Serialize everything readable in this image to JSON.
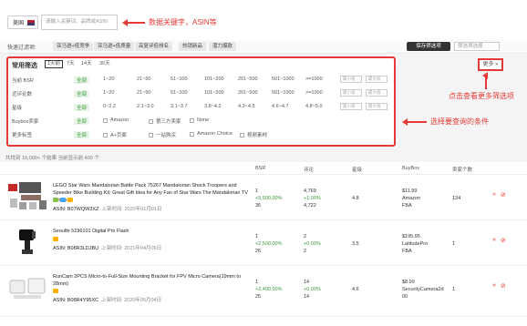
{
  "topbar": {
    "market_label": "美国",
    "search_placeholder": "请输入关键词、品牌或ASIN",
    "search_annotation": "数据关键字，ASIN等"
  },
  "filterbar": {
    "label": "快速过滤项:",
    "chips": [
      "亚马逊+低竞争",
      "亚马逊+低质量",
      "高复评低排名",
      "热销新品",
      "潜力爆款"
    ],
    "save_label": "保存筛选项",
    "select_placeholder": "筛选项选择"
  },
  "panel": {
    "title": "常用筛选",
    "ranges": [
      "1天前",
      "7天",
      "14天",
      "30天"
    ],
    "rows": [
      {
        "label": "当前 BSR",
        "options": [
          "全部",
          "1~20",
          "21~50",
          "51~100",
          "101~200",
          "201~500",
          "501~1000",
          ">=1000"
        ],
        "min": "最小值",
        "max": "最大值"
      },
      {
        "label": "近评论数",
        "options": [
          "全部",
          "1~20",
          "21~50",
          "51~100",
          "101~200",
          "201~500",
          "501~1000",
          ">=1000"
        ],
        "min": "最小值",
        "max": "最大值"
      },
      {
        "label": "星级",
        "options": [
          "全部",
          "0~2.2",
          "2.1~3.0",
          "3.1~3.7",
          "3.8~4.2",
          "4.3~4.5",
          "4.6~4.7",
          "4.8~5.0"
        ],
        "min": "最小值",
        "max": "最大值"
      },
      {
        "label": "Buybox卖家",
        "options": [
          "全部"
        ],
        "checks": [
          "Amazon",
          "第三方卖家",
          "None"
        ]
      },
      {
        "label": "更多标签",
        "options": [
          "全部"
        ],
        "checks": [
          "A+页面",
          "一站购买",
          "Amazon Choice",
          "视频素材"
        ]
      }
    ],
    "annotation": "选择要查询的条件"
  },
  "more": {
    "label": "更多 »",
    "annotation": "点击查看更多筛选项"
  },
  "results": {
    "summary": "共找到 16,000+ 个结果  当前显示前 400 个"
  },
  "table": {
    "headers": {
      "bsr": "BSR",
      "reviews": "评论",
      "rating": "星级",
      "buybox": "BuyBox",
      "sellers": "卖家个数"
    },
    "rows": [
      {
        "title": "LEGO Star Wars Mandalorian Battle Pack 75267 Mandalorian Shock Troopers and Speeder Bike Building Kit; Great Gift Idea for Any Fan of Star Wars The Mandalorian TV Series...",
        "asin": "ASIN: B07WQW3XZ",
        "launch": "上架时间: 2020年01月01日",
        "bsr": [
          "1",
          "+5,500.00%",
          "36"
        ],
        "reviews": [
          "4,769",
          "+1.00%",
          "4,722"
        ],
        "rating": "4.8",
        "buybox": [
          "$11.99",
          "Amazon",
          "FBA"
        ],
        "sellers": "134"
      },
      {
        "title": "Seoulfe 5196101 Digital Pro Flash",
        "asin": "ASIN: B08R3LDJBU",
        "launch": "上架时间: 2021年04月06日",
        "bsr": [
          "1",
          "+2,500.00%",
          "26"
        ],
        "reviews": [
          "2",
          "+0.00%",
          "2"
        ],
        "rating": "3.5",
        "buybox": [
          "$195.95",
          "LatitudePro",
          "FBA"
        ],
        "sellers": "1"
      },
      {
        "title": "RunCam 2PCS Micro-to-Full-Size Mounting Bracket for FPV Micro Camera(19mm to 28mm)",
        "asin": "ASIN: B08R4Y95XC",
        "launch": "上架时间: 2020年05月04日",
        "bsr": [
          "1",
          "+2,400.00%",
          "25"
        ],
        "reviews": [
          "14",
          "+0.00%",
          "14"
        ],
        "rating": "4.6",
        "buybox": [
          "$8.99",
          "SecurityCamera2d",
          "00"
        ],
        "sellers": "1"
      }
    ]
  },
  "colors": {
    "accent": "#e53935",
    "positive": "#3a9a3a"
  }
}
